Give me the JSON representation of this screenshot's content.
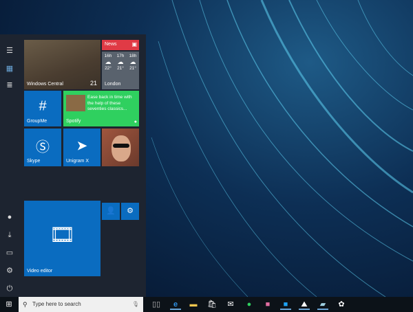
{
  "tiles": {
    "windows_central": {
      "label": "Windows Central",
      "count": "21"
    },
    "news": {
      "label": "News"
    },
    "weather": {
      "hours": [
        "16h",
        "17h",
        "18h"
      ],
      "temps": [
        "22°",
        "21°",
        "21°"
      ],
      "city": "London"
    },
    "groupme": {
      "label": "GroupMe"
    },
    "spotify": {
      "label": "Spotify",
      "text": "Ease back in time with the help of these seventies classics..."
    },
    "skype": {
      "label": "Skype"
    },
    "unigram": {
      "label": "Unigram X"
    },
    "video_editor": {
      "label": "Video editor"
    }
  },
  "search": {
    "placeholder": "Type here to search"
  },
  "colors": {
    "tile_blue": "#0a6cc0",
    "news_red": "#e03a45",
    "spotify_green": "#2fd05f",
    "weather_gray": "#59626d"
  }
}
